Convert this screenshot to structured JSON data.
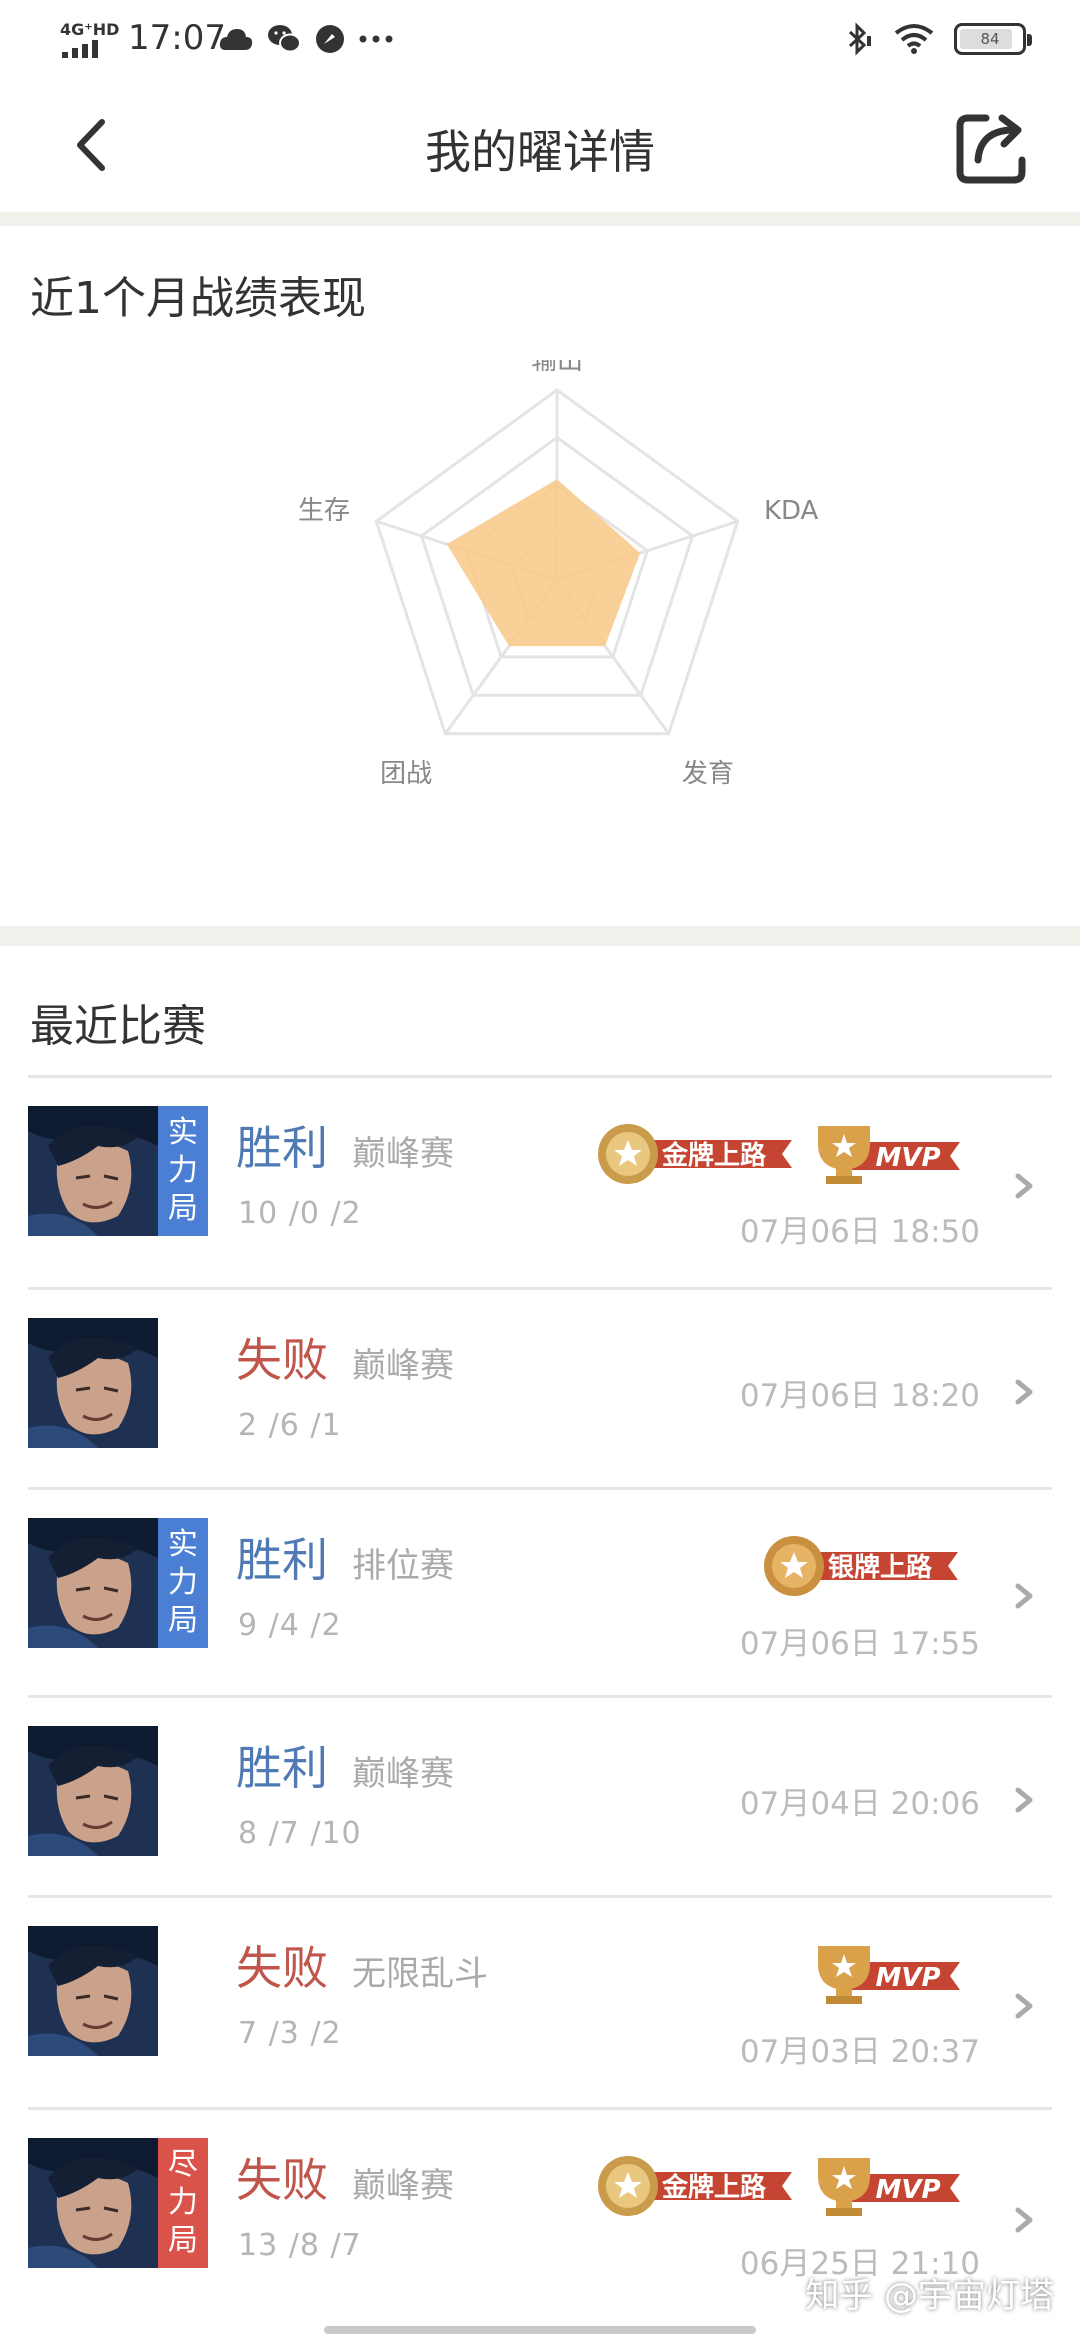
{
  "status_bar": {
    "network": "4G⁺HD",
    "time": "17:07",
    "battery": "84",
    "icons": [
      "cloud-icon",
      "wechat-icon",
      "app-icon",
      "more-dots-icon",
      "bluetooth-icon",
      "wifi-icon",
      "battery-icon"
    ]
  },
  "header": {
    "title": "我的曜详情",
    "back_icon": "chevron-left-icon",
    "share_icon": "share-icon"
  },
  "performance": {
    "title": "近1个月战绩表现",
    "fill_color": "#f7c98a",
    "chart_data": {
      "type": "radar",
      "axes": [
        "输出",
        "KDA",
        "发育",
        "团战",
        "生存"
      ],
      "values": [
        0.53,
        0.46,
        0.43,
        0.43,
        0.61
      ],
      "max": 1
    }
  },
  "recent": {
    "title": "最近比赛",
    "matches": [
      {
        "badge": [
          "实",
          "力",
          "局"
        ],
        "badge_color": "#4a7fd3",
        "result": "胜利",
        "result_color": "#4f7ab3",
        "mode": "巅峰赛",
        "kda": "10 /0 /2",
        "date": "07月06日  18:50",
        "medals": [
          "金牌上路",
          "MVP"
        ]
      },
      {
        "badge": [],
        "badge_color": "",
        "result": "失败",
        "result_color": "#c0564b",
        "mode": "巅峰赛",
        "kda": "2 /6 /1",
        "date": "07月06日  18:20",
        "medals": []
      },
      {
        "badge": [
          "实",
          "力",
          "局"
        ],
        "badge_color": "#4a7fd3",
        "result": "胜利",
        "result_color": "#4f7ab3",
        "mode": "排位赛",
        "kda": "9 /4 /2",
        "date": "07月06日  17:55",
        "medals": [
          "银牌上路"
        ]
      },
      {
        "badge": [],
        "badge_color": "",
        "result": "胜利",
        "result_color": "#4f7ab3",
        "mode": "巅峰赛",
        "kda": "8 /7 /10",
        "date": "07月04日  20:06",
        "medals": []
      },
      {
        "badge": [],
        "badge_color": "",
        "result": "失败",
        "result_color": "#c0564b",
        "mode": "无限乱斗",
        "kda": "7 /3 /2",
        "date": "07月03日  20:37",
        "medals": [
          "MVP"
        ]
      },
      {
        "badge": [
          "尽",
          "力",
          "局"
        ],
        "badge_color": "#d9534a",
        "result": "失败",
        "result_color": "#c0564b",
        "mode": "巅峰赛",
        "kda": "13 /8 /7",
        "date": "06月25日  21:10",
        "medals": [
          "金牌上路",
          "MVP"
        ]
      }
    ]
  },
  "watermark": "知乎 @宇宙灯塔"
}
